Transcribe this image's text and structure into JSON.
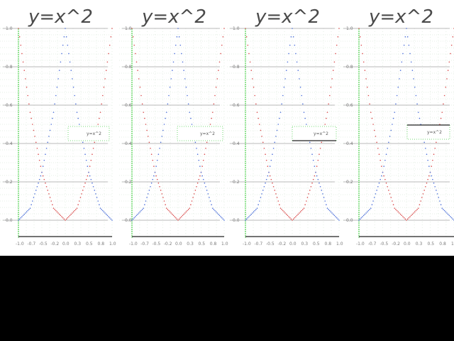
{
  "colors": {
    "background": "#ffffff",
    "grid_major": "#b8b8b8",
    "grid_minor": "#e6efe6",
    "axis_green": "#4fd14f",
    "series_red": "#d94a4a",
    "series_blue": "#4a6ed9",
    "frame": "#222222"
  },
  "chart_data": [
    {
      "type": "line",
      "title": "y=x^2",
      "xlim": [
        -1.0,
        1.0
      ],
      "ylim": [
        0.0,
        1.0
      ],
      "grid": true,
      "legend_label": "y=x^2",
      "series": [
        {
          "name": "",
          "x": [
            -1.0,
            -0.75,
            -0.5,
            -0.25,
            0.0,
            0.25,
            0.5,
            0.75,
            1.0
          ],
          "y": [
            1.0,
            0.5625,
            0.25,
            0.0625,
            0.0,
            0.0625,
            0.25,
            0.5625,
            1.0
          ]
        },
        {
          "name": "",
          "x": [
            -1.0,
            -0.75,
            -0.5,
            -0.25,
            0.0,
            0.25,
            0.5,
            0.75,
            1.0
          ],
          "y": [
            0.0,
            0.0625,
            0.25,
            0.5625,
            1.0,
            0.5625,
            0.25,
            0.0625,
            0.0
          ]
        }
      ]
    },
    {
      "type": "line",
      "title": "y=x^2",
      "xlim": [
        -1.0,
        1.0
      ],
      "ylim": [
        0.0,
        1.0
      ],
      "grid": true,
      "legend_label": "y=x^2",
      "series": [
        {
          "name": "",
          "x": [
            -1.0,
            -0.75,
            -0.5,
            -0.25,
            0.0,
            0.25,
            0.5,
            0.75,
            1.0
          ],
          "y": [
            1.0,
            0.5625,
            0.25,
            0.0625,
            0.0,
            0.0625,
            0.25,
            0.5625,
            1.0
          ]
        },
        {
          "name": "",
          "x": [
            -1.0,
            -0.75,
            -0.5,
            -0.25,
            0.0,
            0.25,
            0.5,
            0.75,
            1.0
          ],
          "y": [
            0.0,
            0.0625,
            0.25,
            0.5625,
            1.0,
            0.5625,
            0.25,
            0.0625,
            0.0
          ]
        }
      ]
    },
    {
      "type": "line",
      "title": "y=x^2",
      "xlim": [
        -1.0,
        1.0
      ],
      "ylim": [
        0.0,
        1.0
      ],
      "grid": true,
      "legend_label": "y=x^2",
      "series": [
        {
          "name": "",
          "x": [
            -1.0,
            -0.75,
            -0.5,
            -0.25,
            0.0,
            0.25,
            0.5,
            0.75,
            1.0
          ],
          "y": [
            1.0,
            0.5625,
            0.25,
            0.0625,
            0.0,
            0.0625,
            0.25,
            0.5625,
            1.0
          ]
        },
        {
          "name": "",
          "x": [
            -1.0,
            -0.75,
            -0.5,
            -0.25,
            0.0,
            0.25,
            0.5,
            0.75,
            1.0
          ],
          "y": [
            0.0,
            0.0625,
            0.25,
            0.5625,
            1.0,
            0.5625,
            0.25,
            0.0625,
            0.0
          ]
        }
      ]
    },
    {
      "type": "line",
      "title": "y=x^2",
      "xlim": [
        -1.0,
        1.0
      ],
      "ylim": [
        0.0,
        1.0
      ],
      "grid": true,
      "legend_label": "y=x^2",
      "series": [
        {
          "name": "",
          "x": [
            -1.0,
            -0.75,
            -0.5,
            -0.25,
            0.0,
            0.25,
            0.5,
            0.75,
            1.0
          ],
          "y": [
            1.0,
            0.5625,
            0.25,
            0.0625,
            0.0,
            0.0625,
            0.25,
            0.5625,
            1.0
          ]
        },
        {
          "name": "",
          "x": [
            -1.0,
            -0.75,
            -0.5,
            -0.25,
            0.0,
            0.25,
            0.5,
            0.75,
            1.0
          ],
          "y": [
            0.0,
            0.0625,
            0.25,
            0.5625,
            1.0,
            0.5625,
            0.25,
            0.0625,
            0.0
          ]
        }
      ]
    }
  ]
}
